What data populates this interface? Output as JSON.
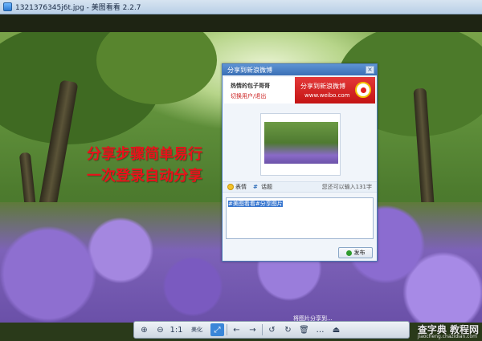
{
  "window": {
    "title": "1321376345j6t.jpg - 美图看看 2.2.7"
  },
  "overlay": {
    "line1": "分享步骤简单易行",
    "line2": "一次登录自动分享"
  },
  "share_dialog": {
    "title": "分享到新浪微博",
    "close_glyph": "×",
    "user_name": "热情的包子哥哥",
    "switch_user": "切换用户/退出",
    "service_title": "分享到新浪微博",
    "service_url": "www.weibo.com",
    "emoji_label": "表情",
    "topic_label": "话题",
    "remaining_text": "您还可以输入131字",
    "text_value": "#美图看看#分享图片",
    "publish_label": "发布"
  },
  "viewer": {
    "caption": "将图片分享到...",
    "toolbar": {
      "zoom_in": "⊕",
      "zoom_out": "⊖",
      "actual_size": "1:1",
      "beautify": "美化",
      "fit": "⤢",
      "prev": "←",
      "next": "→",
      "rotate_left": "↺",
      "rotate_right": "↻",
      "delete": "🗑",
      "more": "…",
      "eject": "⏏"
    }
  },
  "watermark": {
    "text": "查字典 教程网",
    "sub": "jiaocheng.chazidian.com"
  },
  "colors": {
    "banner_red": "#d42222",
    "overlay_red": "#e8121b",
    "dialog_blue": "#3a6fb5"
  }
}
